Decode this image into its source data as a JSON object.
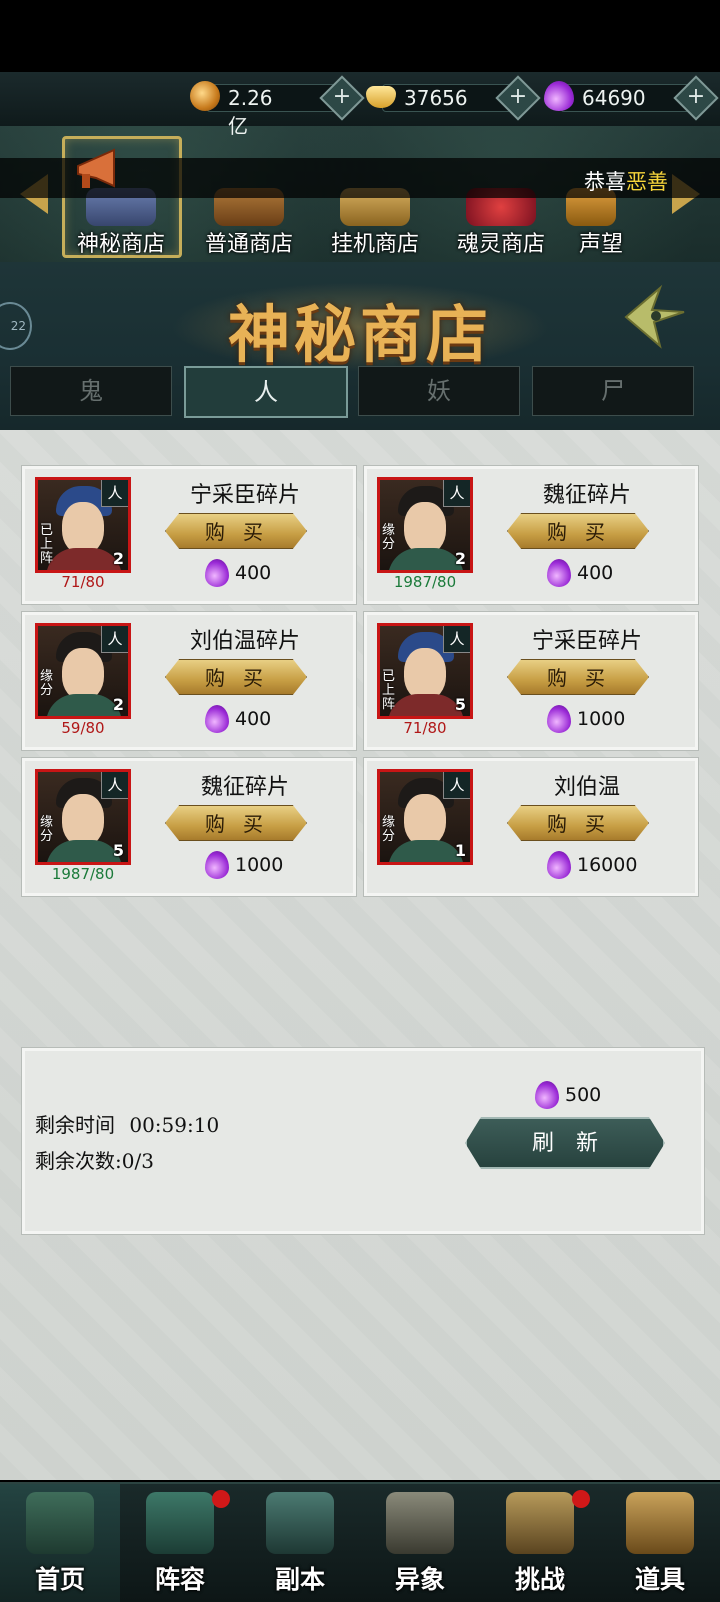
{
  "currency": [
    {
      "icon": "gold-coin-icon",
      "value": "2.26亿"
    },
    {
      "icon": "gold-ingot-icon",
      "value": "37656"
    },
    {
      "icon": "soul-gem-icon",
      "value": "64690"
    }
  ],
  "marquee": {
    "prefix": "恭喜",
    "highlight": "恶善"
  },
  "shop_tabs": [
    {
      "label": "神秘商店",
      "active": true
    },
    {
      "label": "普通商店",
      "active": false
    },
    {
      "label": "挂机商店",
      "active": false
    },
    {
      "label": "魂灵商店",
      "active": false
    },
    {
      "label": "声望",
      "active": false
    }
  ],
  "side_badge": "22",
  "title": "神秘商店",
  "category_tabs": [
    {
      "label": "鬼",
      "active": false
    },
    {
      "label": "人",
      "active": true
    },
    {
      "label": "妖",
      "active": false
    },
    {
      "label": "尸",
      "active": false
    }
  ],
  "items": [
    {
      "name": "宁采臣碎片",
      "tag": "已上阵",
      "count": "2",
      "progress": "71/80",
      "progress_color": "red",
      "price": "400",
      "buy_label": "购买",
      "race": "人"
    },
    {
      "name": "魏征碎片",
      "tag": "缘分",
      "count": "2",
      "progress": "1987/80",
      "progress_color": "green",
      "price": "400",
      "buy_label": "购买",
      "race": "人"
    },
    {
      "name": "刘伯温碎片",
      "tag": "缘分",
      "count": "2",
      "progress": "59/80",
      "progress_color": "red",
      "price": "400",
      "buy_label": "购买",
      "race": "人"
    },
    {
      "name": "宁采臣碎片",
      "tag": "已上阵",
      "count": "5",
      "progress": "71/80",
      "progress_color": "red",
      "price": "1000",
      "buy_label": "购买",
      "race": "人"
    },
    {
      "name": "魏征碎片",
      "tag": "缘分",
      "count": "5",
      "progress": "1987/80",
      "progress_color": "green",
      "price": "1000",
      "buy_label": "购买",
      "race": "人"
    },
    {
      "name": "刘伯温",
      "tag": "缘分",
      "count": "1",
      "progress": "",
      "progress_color": "red",
      "price": "16000",
      "buy_label": "购买",
      "race": "人"
    }
  ],
  "refresh": {
    "time_label": "剩余时间",
    "time_value": "00:59:10",
    "count_label": "剩余次数:0/3",
    "cost": "500",
    "button_label": "刷新"
  },
  "bottom_nav": [
    {
      "label": "首页",
      "active": true,
      "badge": false
    },
    {
      "label": "阵容",
      "active": false,
      "badge": true
    },
    {
      "label": "副本",
      "active": false,
      "badge": false
    },
    {
      "label": "异象",
      "active": false,
      "badge": false
    },
    {
      "label": "挑战",
      "active": false,
      "badge": true
    },
    {
      "label": "道具",
      "active": false,
      "badge": false
    }
  ]
}
